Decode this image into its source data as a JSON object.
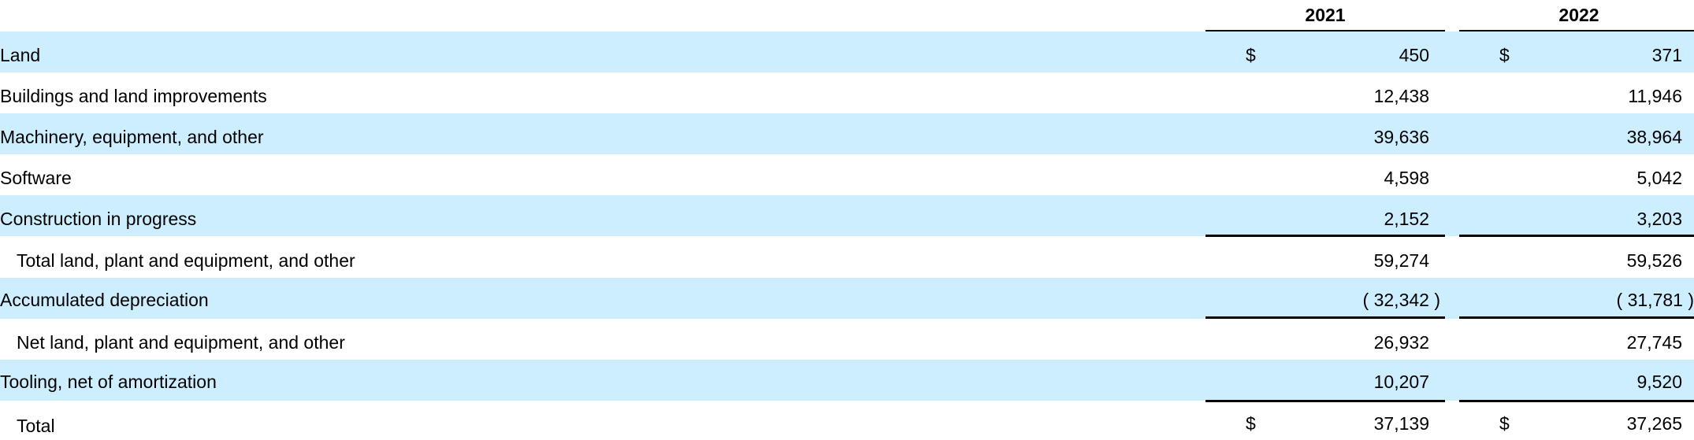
{
  "header": {
    "col1": "2021",
    "col2": "2022"
  },
  "rows": [
    {
      "label": "Land",
      "cur1": "$",
      "v1": "450",
      "cur2": "$",
      "v2": "371"
    },
    {
      "label": "Buildings and land improvements",
      "v1": "12,438",
      "v2": "11,946"
    },
    {
      "label": "Machinery, equipment, and other",
      "v1": "39,636",
      "v2": "38,964"
    },
    {
      "label": "Software",
      "v1": "4,598",
      "v2": "5,042"
    },
    {
      "label": "Construction in progress",
      "v1": "2,152",
      "v2": "3,203"
    },
    {
      "label": "Total land, plant and equipment, and other",
      "v1": "59,274",
      "v2": "59,526"
    },
    {
      "label": "Accumulated depreciation",
      "v1": "( 32,342 )",
      "v2": "( 31,781 )"
    },
    {
      "label": "Net land, plant and equipment, and other",
      "v1": "26,932",
      "v2": "27,745"
    },
    {
      "label": "Tooling, net of amortization",
      "v1": "10,207",
      "v2": "9,520"
    },
    {
      "label": "Total",
      "cur1": "$",
      "v1": "37,139",
      "cur2": "$",
      "v2": "37,265"
    }
  ]
}
